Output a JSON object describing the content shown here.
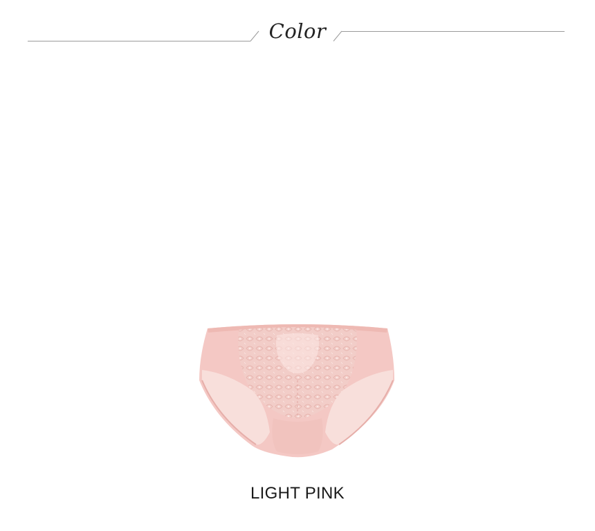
{
  "section": {
    "title": "Color"
  },
  "product": {
    "color_name": "LIGHT PINK",
    "garment_icon": "briefs-garment-image",
    "colors": {
      "base": "#f4c8c4",
      "panel": "#f7dcd8",
      "lace": "#efc0bb",
      "lace_highlight": "#fbe6e3",
      "shadow": "#e6aea9"
    }
  }
}
